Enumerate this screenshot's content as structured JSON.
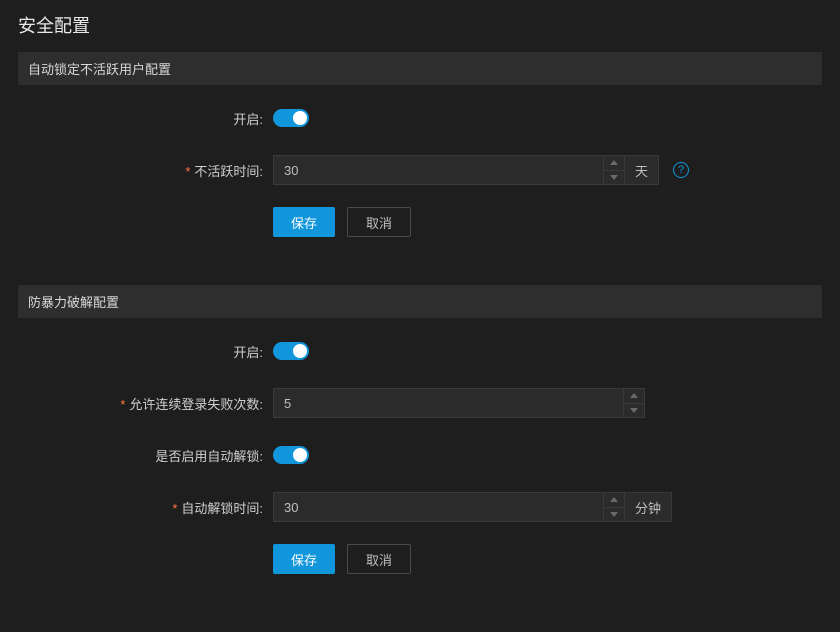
{
  "page_title": "安全配置",
  "section1": {
    "header": "自动锁定不活跃用户配置",
    "enable_label": "开启:",
    "enable_value": true,
    "inactive_time_label": "不活跃时间:",
    "inactive_time_value": "30",
    "inactive_time_unit": "天",
    "save_label": "保存",
    "cancel_label": "取消"
  },
  "section2": {
    "header": "防暴力破解配置",
    "enable_label": "开启:",
    "enable_value": true,
    "max_fail_label": "允许连续登录失败次数:",
    "max_fail_value": "5",
    "auto_unlock_enable_label": "是否启用自动解锁:",
    "auto_unlock_enable_value": true,
    "auto_unlock_time_label": "自动解锁时间:",
    "auto_unlock_time_value": "30",
    "auto_unlock_time_unit": "分钟",
    "save_label": "保存",
    "cancel_label": "取消"
  }
}
